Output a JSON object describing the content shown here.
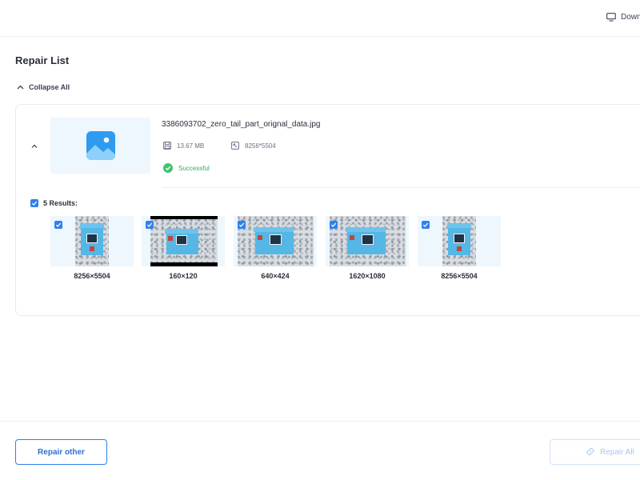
{
  "header": {
    "download_label": "Download",
    "download_icon": "monitor-icon"
  },
  "page": {
    "title": "Repair List",
    "collapse_all_label": "Collapse All"
  },
  "file": {
    "name": "3386093702_zero_tail_part_orignal_data.jpg",
    "size": "13.67 MB",
    "dimensions": "8256*5504",
    "status": "Successful",
    "status_color": "#3aa85a"
  },
  "results": {
    "heading": "5 Results:",
    "checked": true,
    "items": [
      {
        "label": "8256×5504",
        "checked": true
      },
      {
        "label": "160×120",
        "checked": true
      },
      {
        "label": "640×424",
        "checked": true
      },
      {
        "label": "1620×1080",
        "checked": true
      },
      {
        "label": "8256×5504",
        "checked": true
      }
    ]
  },
  "footer": {
    "repair_other_label": "Repair other",
    "repair_all_label": "Repair All"
  },
  "colors": {
    "accent": "#2f80ed",
    "thumb_background": "#eef6fe",
    "success": "#3aa85a",
    "disabled_text": "#a9c6ee"
  }
}
